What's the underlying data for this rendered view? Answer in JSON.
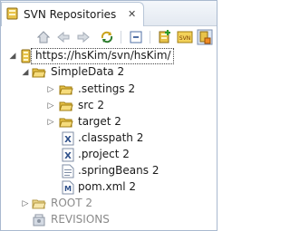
{
  "tab": {
    "title": "SVN Repositories",
    "close": "✕"
  },
  "toolbar": {
    "buttons": [
      "home-icon",
      "back-icon",
      "forward-icon",
      "refresh-icon",
      "collapse-all-icon",
      "new-repository-icon",
      "svn-import-icon",
      "link-with-editor-icon"
    ]
  },
  "tree": {
    "repo": "https://hsKim/svn/hsKim/",
    "project": "SimpleData 2",
    "children": [
      {
        "label": ".settings 2",
        "type": "folder"
      },
      {
        "label": "src 2",
        "type": "folder"
      },
      {
        "label": "target 2",
        "type": "folder"
      },
      {
        "label": ".classpath 2",
        "type": "xml-file"
      },
      {
        "label": ".project 2",
        "type": "xml-file"
      },
      {
        "label": ".springBeans 2",
        "type": "text-file"
      },
      {
        "label": "pom.xml 2",
        "type": "maven-file"
      }
    ],
    "root": "ROOT 2",
    "revisions": "REVISIONS"
  }
}
